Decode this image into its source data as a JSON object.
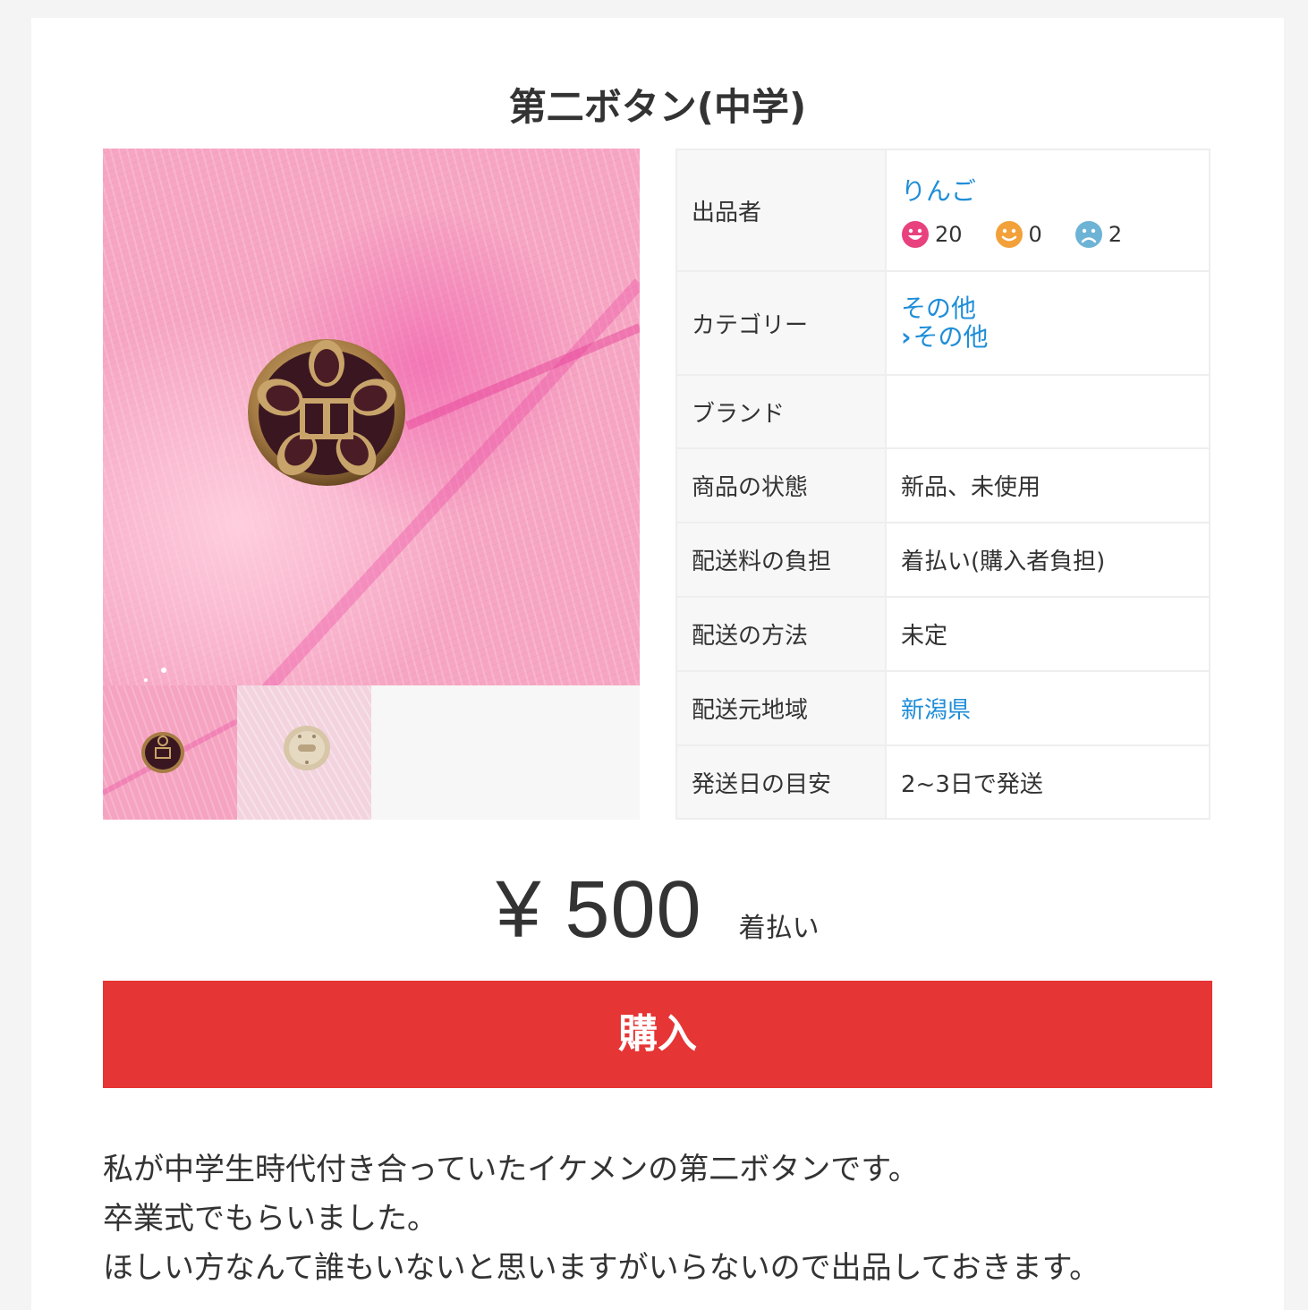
{
  "item": {
    "title": "第二ボタン(中学)"
  },
  "gallery": {
    "main_photo": "school-button-photo",
    "thumbnails": [
      "cherry-blossom-button-front",
      "button-back"
    ]
  },
  "details": {
    "seller_label": "出品者",
    "seller_name": "りんご",
    "ratings": {
      "good": "20",
      "normal": "0",
      "bad": "2"
    },
    "category_label": "カテゴリー",
    "category_primary": "その他",
    "category_secondary": "その他",
    "brand_label": "ブランド",
    "brand_value": "",
    "condition_label": "商品の状態",
    "condition_value": "新品、未使用",
    "shipping_fee_label": "配送料の負担",
    "shipping_fee_value": "着払い(購入者負担)",
    "shipping_method_label": "配送の方法",
    "shipping_method_value": "未定",
    "ship_from_label": "配送元地域",
    "ship_from_value": "新潟県",
    "ship_days_label": "発送日の目安",
    "ship_days_value": "2~3日で発送"
  },
  "price": {
    "amount": "¥ 500",
    "shipping_note": "着払い"
  },
  "buy_button": {
    "label": "購入"
  },
  "description": {
    "lines": [
      "私が中学生時代付き合っていたイケメンの第二ボタンです。",
      "卒業式でもらいました。",
      "ほしい方なんて誰もいないと思いますがいらないので出品しておきます。"
    ]
  },
  "colors": {
    "link": "#1f8ed8",
    "buy_button": "#e53534",
    "rating_good": "#e8417e",
    "rating_normal": "#f2a13a",
    "rating_bad": "#6cb3d6"
  }
}
